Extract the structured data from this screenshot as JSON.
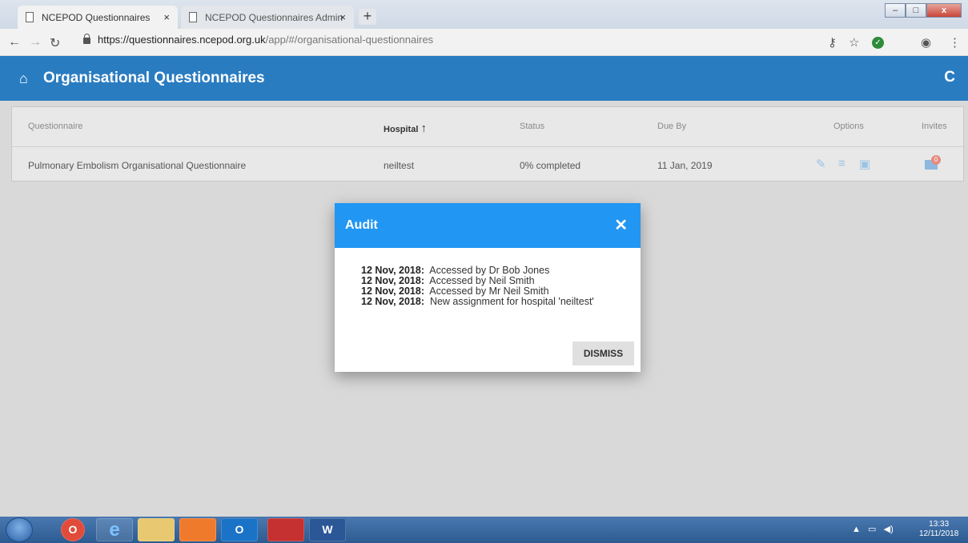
{
  "browser": {
    "tabs": [
      {
        "title": "NCEPOD Questionnaires",
        "close": "×"
      },
      {
        "title": "NCEPOD Questionnaires Admin",
        "close": "×"
      }
    ],
    "new_tab": "+",
    "url_host": "https://questionnaires.ncepod.org.uk",
    "url_path": "/app/#/organisational-questionnaires"
  },
  "header": {
    "title": "Organisational Questionnaires",
    "home_icon": "⌂",
    "refresh_icon": "C"
  },
  "table": {
    "columns": {
      "questionnaire": "Questionnaire",
      "hospital": "Hospital",
      "status": "Status",
      "due_by": "Due By",
      "options": "Options",
      "invites": "Invites"
    },
    "sort_arrow": "↑",
    "rows": [
      {
        "questionnaire": "Pulmonary Embolism Organisational Questionnaire",
        "hospital": "neiltest",
        "status": "0% completed",
        "due_by": "11 Jan, 2019",
        "invite_count": "0"
      }
    ]
  },
  "dialog": {
    "title": "Audit",
    "close": "✕",
    "entries": [
      {
        "date": "12 Nov, 2018:",
        "text": "Accessed by Dr Bob Jones"
      },
      {
        "date": "12 Nov, 2018:",
        "text": "Accessed by Neil Smith"
      },
      {
        "date": "12 Nov, 2018:",
        "text": "Accessed by Mr Neil Smith"
      },
      {
        "date": "12 Nov, 2018:",
        "text": "New assignment for hospital 'neiltest'"
      }
    ],
    "dismiss_label": "DISMISS"
  },
  "taskbar": {
    "time": "13:33",
    "date": "12/11/2018",
    "apps": [
      "O",
      "e",
      "",
      "",
      "O",
      "",
      "W"
    ]
  },
  "colors": {
    "header_blue": "#2a7cc1",
    "dialog_blue": "#2196f3",
    "option_icon": "#9bc3e3"
  }
}
